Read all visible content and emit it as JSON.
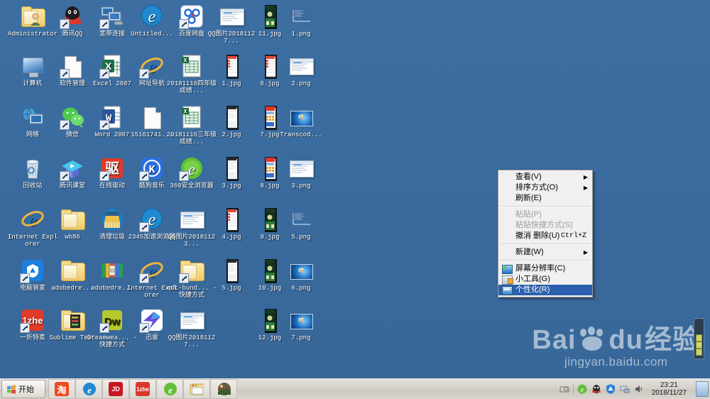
{
  "desktop": {
    "background_color": "#3a6b9e",
    "icons": [
      {
        "label": "Administrator",
        "kind": "folder-user",
        "col": 0,
        "row": 0,
        "shortcut": false
      },
      {
        "label": "腾讯QQ",
        "kind": "qq",
        "col": 1,
        "row": 0,
        "shortcut": true
      },
      {
        "label": "宽带连接",
        "kind": "network-connection",
        "col": 2,
        "row": 0,
        "shortcut": true
      },
      {
        "label": "Untitled...",
        "kind": "ie-edge",
        "col": 3,
        "row": 0,
        "shortcut": false
      },
      {
        "label": "百度网盘",
        "kind": "baidu-pan",
        "col": 4,
        "row": 0,
        "shortcut": true
      },
      {
        "label": "QQ图片20181127...",
        "kind": "window-thumb",
        "col": 5,
        "row": 0,
        "shortcut": false
      },
      {
        "label": "11.jpg",
        "kind": "phone-shot-game",
        "col": 6,
        "row": 0,
        "shortcut": false
      },
      {
        "label": "1.png",
        "kind": "chart-shot",
        "col": 7,
        "row": 0,
        "shortcut": false
      },
      {
        "label": "计算机",
        "kind": "computer",
        "col": 0,
        "row": 1,
        "shortcut": false
      },
      {
        "label": "软件管理",
        "kind": "page",
        "col": 1,
        "row": 1,
        "shortcut": true
      },
      {
        "label": "Excel 2007",
        "kind": "excel",
        "col": 2,
        "row": 1,
        "shortcut": true
      },
      {
        "label": "网址导航",
        "kind": "ie-classic",
        "col": 3,
        "row": 1,
        "shortcut": true
      },
      {
        "label": "20181116四年级成绩...",
        "kind": "excel-file",
        "col": 4,
        "row": 1,
        "shortcut": false
      },
      {
        "label": "1.jpg",
        "kind": "phone-shot-list",
        "col": 5,
        "row": 1,
        "shortcut": false
      },
      {
        "label": "6.jpg",
        "kind": "phone-shot-list",
        "col": 6,
        "row": 1,
        "shortcut": false
      },
      {
        "label": "2.png",
        "kind": "window-thumb",
        "col": 7,
        "row": 1,
        "shortcut": false
      },
      {
        "label": "网络",
        "kind": "network",
        "col": 0,
        "row": 2,
        "shortcut": false
      },
      {
        "label": "微信",
        "kind": "wechat",
        "col": 1,
        "row": 2,
        "shortcut": true
      },
      {
        "label": "Word 2007",
        "kind": "word",
        "col": 2,
        "row": 2,
        "shortcut": true
      },
      {
        "label": "15161741...",
        "kind": "page",
        "col": 3,
        "row": 2,
        "shortcut": false
      },
      {
        "label": "20181116三年级成绩...",
        "kind": "excel-file",
        "col": 4,
        "row": 2,
        "shortcut": false
      },
      {
        "label": "2.jpg",
        "kind": "phone-shot-doc",
        "col": 5,
        "row": 2,
        "shortcut": false
      },
      {
        "label": "7.jpg",
        "kind": "phone-shot-red",
        "col": 6,
        "row": 2,
        "shortcut": false
      },
      {
        "label": "Transcod...",
        "kind": "wallpaper",
        "col": 7,
        "row": 2,
        "shortcut": false
      },
      {
        "label": "回收站",
        "kind": "recycle-bin",
        "col": 0,
        "row": 3,
        "shortcut": false
      },
      {
        "label": "腾讯课堂",
        "kind": "tencent-class",
        "col": 1,
        "row": 3,
        "shortcut": true
      },
      {
        "label": "在线驱动",
        "kind": "driver",
        "col": 2,
        "row": 3,
        "shortcut": true
      },
      {
        "label": "酷狗音乐",
        "kind": "kugou",
        "col": 3,
        "row": 3,
        "shortcut": true
      },
      {
        "label": "360安全浏览器",
        "kind": "browser360",
        "col": 4,
        "row": 3,
        "shortcut": true
      },
      {
        "label": "3.jpg",
        "kind": "phone-shot-doc",
        "col": 5,
        "row": 3,
        "shortcut": false
      },
      {
        "label": "8.jpg",
        "kind": "phone-shot-red",
        "col": 6,
        "row": 3,
        "shortcut": false
      },
      {
        "label": "3.png",
        "kind": "window-thumb",
        "col": 7,
        "row": 3,
        "shortcut": false
      },
      {
        "label": "Internet Explorer",
        "kind": "ie-classic",
        "col": 0,
        "row": 4,
        "shortcut": false
      },
      {
        "label": "wb86",
        "kind": "folder",
        "col": 1,
        "row": 4,
        "shortcut": false
      },
      {
        "label": "清理垃圾",
        "kind": "clean-broom",
        "col": 2,
        "row": 4,
        "shortcut": false
      },
      {
        "label": "2345加速浏览器",
        "kind": "ie-edge",
        "col": 3,
        "row": 4,
        "shortcut": true
      },
      {
        "label": "QQ图片20181123...",
        "kind": "window-thumb",
        "col": 4,
        "row": 4,
        "shortcut": false
      },
      {
        "label": "4.jpg",
        "kind": "phone-shot-list",
        "col": 5,
        "row": 4,
        "shortcut": false
      },
      {
        "label": "9.jpg",
        "kind": "phone-shot-game",
        "col": 6,
        "row": 4,
        "shortcut": false
      },
      {
        "label": "5.png",
        "kind": "chart-shot",
        "col": 7,
        "row": 4,
        "shortcut": false
      },
      {
        "label": "电脑管家",
        "kind": "pc-manager",
        "col": 0,
        "row": 5,
        "shortcut": true
      },
      {
        "label": "adobedre...",
        "kind": "folder",
        "col": 1,
        "row": 5,
        "shortcut": false
      },
      {
        "label": "adobedre...",
        "kind": "winrar",
        "col": 2,
        "row": 5,
        "shortcut": false
      },
      {
        "label": "Internet Explorer",
        "kind": "ie-classic",
        "col": 3,
        "row": 5,
        "shortcut": true
      },
      {
        "label": "adt-bund... - 快捷方式",
        "kind": "folder",
        "col": 4,
        "row": 5,
        "shortcut": true
      },
      {
        "label": "5.jpg",
        "kind": "phone-shot-doc",
        "col": 5,
        "row": 5,
        "shortcut": false
      },
      {
        "label": "10.jpg",
        "kind": "phone-shot-game",
        "col": 6,
        "row": 5,
        "shortcut": false
      },
      {
        "label": "6.png",
        "kind": "wallpaper",
        "col": 7,
        "row": 5,
        "shortcut": false
      },
      {
        "label": "一折特卖",
        "kind": "yizhe",
        "col": 0,
        "row": 6,
        "shortcut": true
      },
      {
        "label": "Sublime Text",
        "kind": "sublime",
        "col": 1,
        "row": 6,
        "shortcut": false
      },
      {
        "label": "Dreamwea... - 快捷方式",
        "kind": "dreamweaver",
        "col": 2,
        "row": 6,
        "shortcut": true
      },
      {
        "label": "迅雷",
        "kind": "thunder",
        "col": 3,
        "row": 6,
        "shortcut": true
      },
      {
        "label": "QQ图片20181127...",
        "kind": "window-thumb",
        "col": 4,
        "row": 6,
        "shortcut": false
      },
      {
        "label": "12.jpg",
        "kind": "phone-shot-game",
        "col": 6,
        "row": 6,
        "shortcut": false
      },
      {
        "label": "7.png",
        "kind": "wallpaper",
        "col": 7,
        "row": 6,
        "shortcut": false
      }
    ]
  },
  "context_menu": {
    "highlight_color": "#2b5fad",
    "items": [
      {
        "label": "查看(V)",
        "type": "submenu",
        "disabled": false,
        "selected": false,
        "icon": null,
        "accel": null
      },
      {
        "label": "排序方式(O)",
        "type": "submenu",
        "disabled": false,
        "selected": false,
        "icon": null,
        "accel": null
      },
      {
        "label": "刷新(E)",
        "type": "item",
        "disabled": false,
        "selected": false,
        "icon": null,
        "accel": null
      },
      {
        "type": "separator"
      },
      {
        "label": "粘贴(P)",
        "type": "item",
        "disabled": true,
        "selected": false,
        "icon": null,
        "accel": null
      },
      {
        "label": "粘贴快捷方式(S)",
        "type": "item",
        "disabled": true,
        "selected": false,
        "icon": null,
        "accel": null
      },
      {
        "label": "撤消 删除(U)",
        "type": "item",
        "disabled": false,
        "selected": false,
        "icon": null,
        "accel": "Ctrl+Z"
      },
      {
        "type": "separator"
      },
      {
        "label": "新建(W)",
        "type": "submenu",
        "disabled": false,
        "selected": false,
        "icon": null,
        "accel": null
      },
      {
        "type": "separator"
      },
      {
        "label": "屏幕分辨率(C)",
        "type": "item",
        "disabled": false,
        "selected": false,
        "icon": "screen-resolution-icon",
        "accel": null
      },
      {
        "label": "小工具(G)",
        "type": "item",
        "disabled": false,
        "selected": false,
        "icon": "gadgets-icon",
        "accel": null
      },
      {
        "label": "个性化(R)",
        "type": "item",
        "disabled": false,
        "selected": true,
        "icon": "personalize-icon",
        "accel": null
      }
    ]
  },
  "taskbar": {
    "start_label": "开始",
    "quick_launch": [
      {
        "name": "taobao",
        "label": "淘",
        "color": "#ef4a21"
      },
      {
        "name": "ie-browser",
        "label": "e",
        "color": "#1f7fc6"
      },
      {
        "name": "jd",
        "label": "JD",
        "color": "#c81623"
      },
      {
        "name": "yizhe",
        "label": "1zhe",
        "color": "#d93a2b"
      },
      {
        "name": "360-browser",
        "label": "e",
        "color": "#63bf3a"
      },
      {
        "name": "file-explorer",
        "label": "",
        "color": "#f0c96a"
      },
      {
        "name": "photo-viewer",
        "label": "",
        "color": "#8a7258"
      }
    ],
    "tray": [
      {
        "name": "hidden-icons-arrow"
      },
      {
        "name": "ie-tray-icon"
      },
      {
        "name": "qq-tray-icon"
      },
      {
        "name": "pc-manager-tray-icon"
      },
      {
        "name": "network-tray-icon"
      },
      {
        "name": "volume-tray-icon"
      }
    ],
    "clock_time": "23:21",
    "clock_date": "2018/11/27"
  },
  "watermark": {
    "brand_first": "Bai",
    "brand_second": "du",
    "brand_suffix": "经验",
    "url": "jingyan.baidu.com"
  }
}
